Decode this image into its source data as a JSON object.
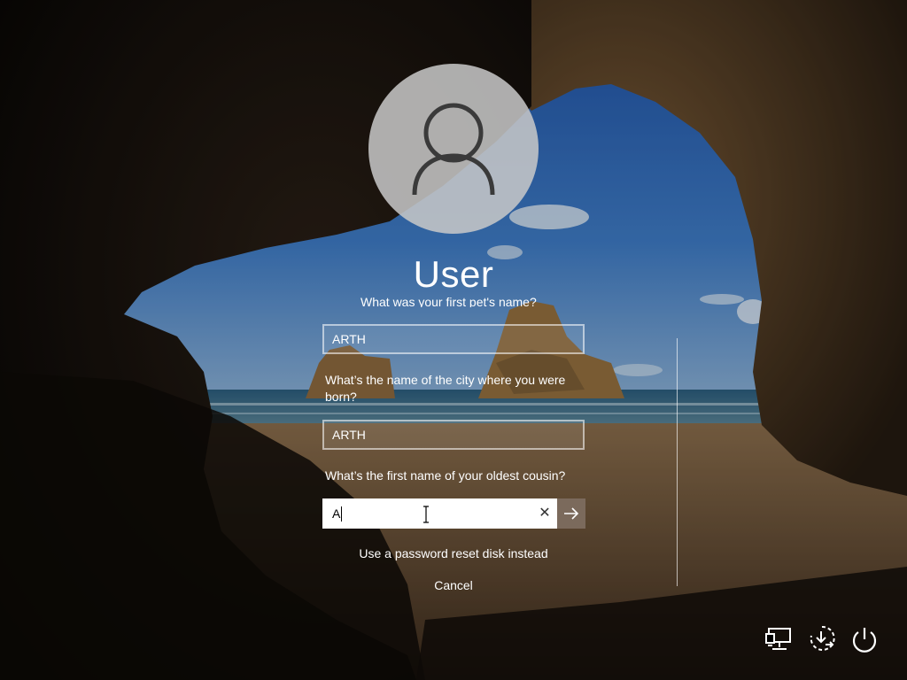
{
  "user": {
    "name": "User"
  },
  "security_questions": [
    {
      "question": "What was your first pet's name?",
      "answer": "ARTH"
    },
    {
      "question": "What’s the name of the city where you were born?",
      "answer": "ARTH"
    },
    {
      "question": "What’s the first name of your oldest cousin?",
      "answer": "A"
    }
  ],
  "links": {
    "reset_disk": "Use a password reset disk instead",
    "cancel": "Cancel"
  },
  "icons": {
    "clear": "close-icon",
    "submit": "arrow-right-icon",
    "network": "network-icon",
    "ease_of_access": "ease-of-access-icon",
    "power": "power-icon"
  },
  "colors": {
    "text": "#ffffff",
    "submit_button": "#7b6a5c",
    "field_border": "#ffffff"
  }
}
